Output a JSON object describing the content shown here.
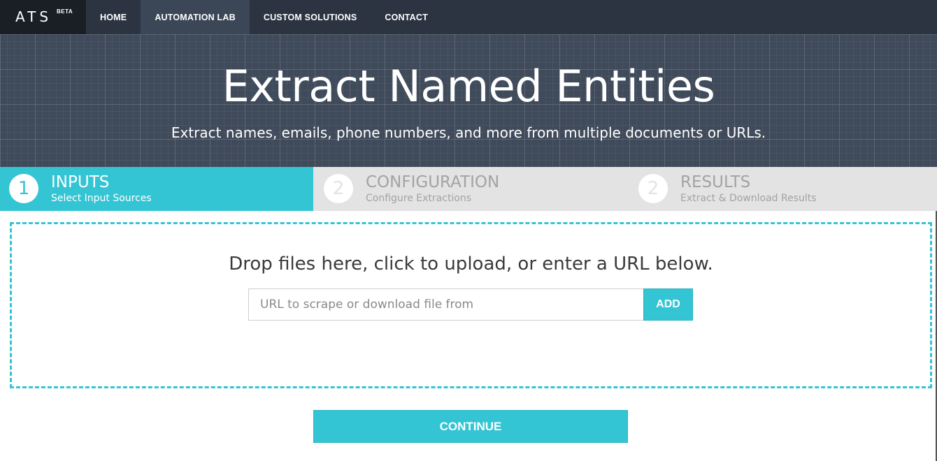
{
  "nav": {
    "brand": "ATS",
    "brand_tag": "BETA",
    "items": [
      {
        "label": "HOME",
        "active": false
      },
      {
        "label": "AUTOMATION LAB",
        "active": true
      },
      {
        "label": "CUSTOM SOLUTIONS",
        "active": false
      },
      {
        "label": "CONTACT",
        "active": false
      }
    ]
  },
  "hero": {
    "title": "Extract Named Entities",
    "subtitle": "Extract names, emails, phone numbers, and more from multiple documents or URLs."
  },
  "steps": [
    {
      "number": "1",
      "title": "INPUTS",
      "description": "Select Input Sources",
      "active": true
    },
    {
      "number": "2",
      "title": "CONFIGURATION",
      "description": "Configure Extractions",
      "active": false
    },
    {
      "number": "2",
      "title": "RESULTS",
      "description": "Extract & Download Results",
      "active": false
    }
  ],
  "dropzone": {
    "prompt": "Drop files here, click to upload, or enter a URL below.",
    "url_input": {
      "value": "",
      "placeholder": "URL to scrape or download file from"
    },
    "add_label": "ADD"
  },
  "continue_label": "CONTINUE",
  "colors": {
    "accent": "#33c5d3",
    "navbar": "#2b3440",
    "brand_bg": "#1a1f26",
    "hero_bg": "#3f4a5a",
    "inactive_step_bg": "#e3e3e3",
    "inactive_step_text": "#a3a3a3"
  }
}
